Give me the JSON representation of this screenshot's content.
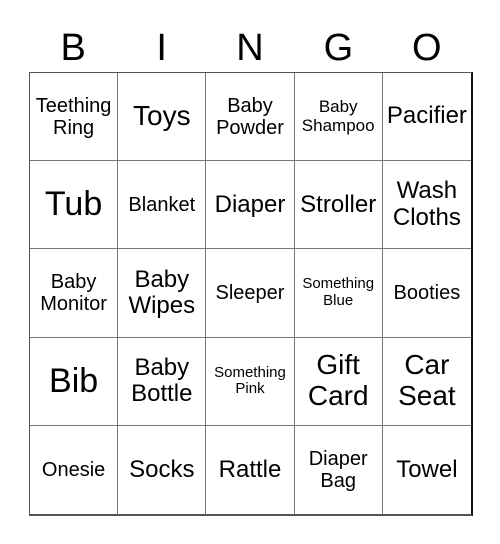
{
  "header": {
    "letters": [
      "B",
      "I",
      "N",
      "G",
      "O"
    ]
  },
  "cells": [
    [
      "Teething Ring",
      "Toys",
      "Baby Powder",
      "Baby Shampoo",
      "Pacifier"
    ],
    [
      "Tub",
      "Blanket",
      "Diaper",
      "Stroller",
      "Wash Cloths"
    ],
    [
      "Baby Monitor",
      "Baby Wipes",
      "Sleeper",
      "Something Blue",
      "Booties"
    ],
    [
      "Bib",
      "Baby Bottle",
      "Something Pink",
      "Gift Card",
      "Car Seat"
    ],
    [
      "Onesie",
      "Socks",
      "Rattle",
      "Diaper Bag",
      "Towel"
    ]
  ]
}
